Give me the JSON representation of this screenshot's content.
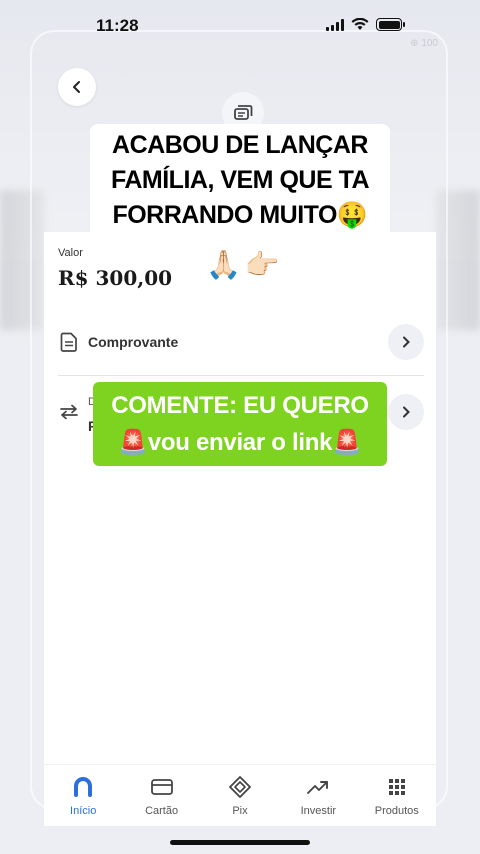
{
  "status_bar": {
    "time": "11:28",
    "faint_text": "⊕ 100"
  },
  "transfer": {
    "value_label": "Valor",
    "value_amount": "R$ 300,00",
    "rows": [
      {
        "label": "Comprovante",
        "icon": "document-icon"
      },
      {
        "sub": "D",
        "value": "P",
        "icon": "transfer-arrows-icon"
      }
    ]
  },
  "overlay": {
    "headline_lines": [
      "ACABOU DE LANÇAR",
      "FAMÍLIA, VEM QUE TA",
      "FORRANDO MUITO🤑"
    ],
    "emoji_line": "🙏🏻👉🏻",
    "cta_line1": "COMENTE: EU QUERO",
    "cta_line2": "🚨vou enviar o link🚨",
    "cta_color": "#7ed321"
  },
  "bottom_nav": {
    "items": [
      {
        "label": "Início",
        "icon": "home-icon",
        "active": true
      },
      {
        "label": "Cartão",
        "icon": "card-icon",
        "active": false
      },
      {
        "label": "Pix",
        "icon": "pix-icon",
        "active": false
      },
      {
        "label": "Investir",
        "icon": "chart-up-icon",
        "active": false
      },
      {
        "label": "Produtos",
        "icon": "grid-icon",
        "active": false
      }
    ],
    "active_color": "#2c6fdb"
  }
}
